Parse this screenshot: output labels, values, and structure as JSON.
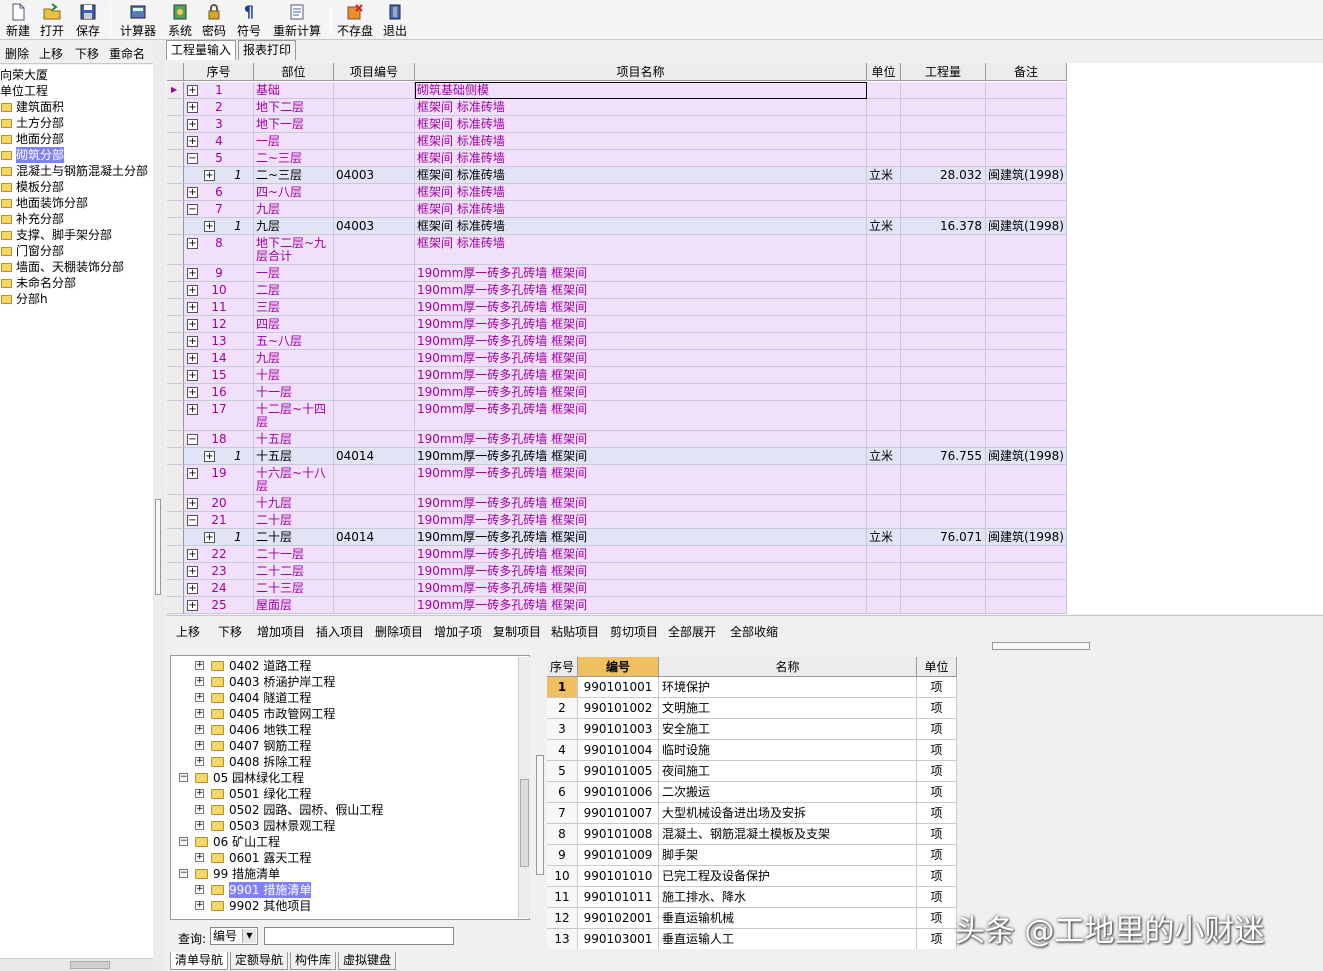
{
  "toolbar": {
    "new": "新建",
    "open": "打开",
    "save": "保存",
    "calc": "计算器",
    "system": "系统",
    "password": "密码",
    "symbol": "符号",
    "recalc": "重新计算",
    "nosave": "不存盘",
    "exit": "退出"
  },
  "left_toolbar": {
    "delete": "删除",
    "up": "上移",
    "down": "下移",
    "rename": "重命名"
  },
  "left_tree": {
    "project": "向荣大厦",
    "unit": "单位工程",
    "items": [
      "建筑面积",
      "土方分部",
      "地面分部",
      "砌筑分部",
      "混凝土与钢筋混凝土分部",
      "模板分部",
      "地面装饰分部",
      "补充分部",
      "支撑、脚手架分部",
      "门窗分部",
      "墙面、天棚装饰分部",
      "未命名分部",
      "分部h"
    ],
    "selected_index": 3
  },
  "tabs": {
    "input": "工程量输入",
    "report": "报表打印"
  },
  "grid": {
    "headers": {
      "seq": "序号",
      "part": "部位",
      "code": "项目编号",
      "name": "项目名称",
      "unit": "单位",
      "qty": "工程量",
      "note": "备注"
    },
    "rows": [
      {
        "type": "parent",
        "seq": "1",
        "part": "基础",
        "code": "",
        "name": "砌筑基础侧模",
        "unit": "",
        "qty": "",
        "note": "",
        "pm": "+",
        "cur": true
      },
      {
        "type": "parent",
        "seq": "2",
        "part": "地下二层",
        "code": "",
        "name": "框架间 标准砖墙",
        "unit": "",
        "qty": "",
        "note": "",
        "pm": "+"
      },
      {
        "type": "parent",
        "seq": "3",
        "part": "地下一层",
        "code": "",
        "name": "框架间 标准砖墙",
        "unit": "",
        "qty": "",
        "note": "",
        "pm": "+"
      },
      {
        "type": "parent",
        "seq": "4",
        "part": "一层",
        "code": "",
        "name": "框架间 标准砖墙",
        "unit": "",
        "qty": "",
        "note": "",
        "pm": "+"
      },
      {
        "type": "parent",
        "seq": "5",
        "part": "二~三层",
        "code": "",
        "name": "框架间 标准砖墙",
        "unit": "",
        "qty": "",
        "note": "",
        "pm": "−"
      },
      {
        "type": "child",
        "seq": "1",
        "part": "二~三层",
        "code": "04003",
        "name": "框架间 标准砖墙",
        "unit": "立米",
        "qty": "28.032",
        "note": "闽建筑(1998)",
        "pm": "+"
      },
      {
        "type": "parent",
        "seq": "6",
        "part": "四~八层",
        "code": "",
        "name": "框架间 标准砖墙",
        "unit": "",
        "qty": "",
        "note": "",
        "pm": "+"
      },
      {
        "type": "parent",
        "seq": "7",
        "part": "九层",
        "code": "",
        "name": "框架间 标准砖墙",
        "unit": "",
        "qty": "",
        "note": "",
        "pm": "−"
      },
      {
        "type": "child",
        "seq": "1",
        "part": "九层",
        "code": "04003",
        "name": "框架间 标准砖墙",
        "unit": "立米",
        "qty": "16.378",
        "note": "闽建筑(1998)",
        "pm": "+"
      },
      {
        "type": "parent",
        "seq": "8",
        "part": "地下二层~九层合计",
        "code": "",
        "name": "框架间 标准砖墙",
        "unit": "",
        "qty": "",
        "note": "",
        "pm": "+",
        "tall": true
      },
      {
        "type": "parent",
        "seq": "9",
        "part": "一层",
        "code": "",
        "name": "190mm厚一砖多孔砖墙 框架间",
        "unit": "",
        "qty": "",
        "note": "",
        "pm": "+"
      },
      {
        "type": "parent",
        "seq": "10",
        "part": "二层",
        "code": "",
        "name": "190mm厚一砖多孔砖墙 框架间",
        "unit": "",
        "qty": "",
        "note": "",
        "pm": "+"
      },
      {
        "type": "parent",
        "seq": "11",
        "part": "三层",
        "code": "",
        "name": "190mm厚一砖多孔砖墙 框架间",
        "unit": "",
        "qty": "",
        "note": "",
        "pm": "+"
      },
      {
        "type": "parent",
        "seq": "12",
        "part": "四层",
        "code": "",
        "name": "190mm厚一砖多孔砖墙 框架间",
        "unit": "",
        "qty": "",
        "note": "",
        "pm": "+"
      },
      {
        "type": "parent",
        "seq": "13",
        "part": "五~八层",
        "code": "",
        "name": "190mm厚一砖多孔砖墙 框架间",
        "unit": "",
        "qty": "",
        "note": "",
        "pm": "+"
      },
      {
        "type": "parent",
        "seq": "14",
        "part": "九层",
        "code": "",
        "name": "190mm厚一砖多孔砖墙 框架间",
        "unit": "",
        "qty": "",
        "note": "",
        "pm": "+"
      },
      {
        "type": "parent",
        "seq": "15",
        "part": "十层",
        "code": "",
        "name": "190mm厚一砖多孔砖墙 框架间",
        "unit": "",
        "qty": "",
        "note": "",
        "pm": "+"
      },
      {
        "type": "parent",
        "seq": "16",
        "part": "十一层",
        "code": "",
        "name": "190mm厚一砖多孔砖墙 框架间",
        "unit": "",
        "qty": "",
        "note": "",
        "pm": "+"
      },
      {
        "type": "parent",
        "seq": "17",
        "part": "十二层~十四层",
        "code": "",
        "name": "190mm厚一砖多孔砖墙 框架间",
        "unit": "",
        "qty": "",
        "note": "",
        "pm": "+",
        "tall": true
      },
      {
        "type": "parent",
        "seq": "18",
        "part": "十五层",
        "code": "",
        "name": "190mm厚一砖多孔砖墙 框架间",
        "unit": "",
        "qty": "",
        "note": "",
        "pm": "−"
      },
      {
        "type": "child",
        "seq": "1",
        "part": "十五层",
        "code": "04014",
        "name": "190mm厚一砖多孔砖墙 框架间",
        "unit": "立米",
        "qty": "76.755",
        "note": "闽建筑(1998)",
        "pm": "+"
      },
      {
        "type": "parent",
        "seq": "19",
        "part": "十六层~十八层",
        "code": "",
        "name": "190mm厚一砖多孔砖墙 框架间",
        "unit": "",
        "qty": "",
        "note": "",
        "pm": "+",
        "tall": true
      },
      {
        "type": "parent",
        "seq": "20",
        "part": "十九层",
        "code": "",
        "name": "190mm厚一砖多孔砖墙 框架间",
        "unit": "",
        "qty": "",
        "note": "",
        "pm": "+"
      },
      {
        "type": "parent",
        "seq": "21",
        "part": "二十层",
        "code": "",
        "name": "190mm厚一砖多孔砖墙 框架间",
        "unit": "",
        "qty": "",
        "note": "",
        "pm": "−"
      },
      {
        "type": "child",
        "seq": "1",
        "part": "二十层",
        "code": "04014",
        "name": "190mm厚一砖多孔砖墙 框架间",
        "unit": "立米",
        "qty": "76.071",
        "note": "闽建筑(1998)",
        "pm": "+"
      },
      {
        "type": "parent",
        "seq": "22",
        "part": "二十一层",
        "code": "",
        "name": "190mm厚一砖多孔砖墙 框架间",
        "unit": "",
        "qty": "",
        "note": "",
        "pm": "+"
      },
      {
        "type": "parent",
        "seq": "23",
        "part": "二十二层",
        "code": "",
        "name": "190mm厚一砖多孔砖墙 框架间",
        "unit": "",
        "qty": "",
        "note": "",
        "pm": "+"
      },
      {
        "type": "parent",
        "seq": "24",
        "part": "二十三层",
        "code": "",
        "name": "190mm厚一砖多孔砖墙 框架间",
        "unit": "",
        "qty": "",
        "note": "",
        "pm": "+"
      },
      {
        "type": "parent",
        "seq": "25",
        "part": "屋面层",
        "code": "",
        "name": "190mm厚一砖多孔砖墙 框架间",
        "unit": "",
        "qty": "",
        "note": "",
        "pm": "+"
      }
    ]
  },
  "buttons": [
    "上移",
    "下移",
    "增加项目",
    "插入项目",
    "删除项目",
    "增加子项",
    "复制项目",
    "粘贴项目",
    "剪切项目",
    "全部展开",
    "全部收缩"
  ],
  "nav_tree": [
    {
      "level": 2,
      "pm": "+",
      "label": "0402 道路工程"
    },
    {
      "level": 2,
      "pm": "+",
      "label": "0403 桥涵护岸工程"
    },
    {
      "level": 2,
      "pm": "+",
      "label": "0404 隧道工程"
    },
    {
      "level": 2,
      "pm": "+",
      "label": "0405 市政管网工程"
    },
    {
      "level": 2,
      "pm": "+",
      "label": "0406 地铁工程"
    },
    {
      "level": 2,
      "pm": "+",
      "label": "0407 钢筋工程"
    },
    {
      "level": 2,
      "pm": "+",
      "label": "0408 拆除工程"
    },
    {
      "level": 1,
      "pm": "−",
      "label": "05  园林绿化工程"
    },
    {
      "level": 2,
      "pm": "+",
      "label": "0501 绿化工程"
    },
    {
      "level": 2,
      "pm": "+",
      "label": "0502 园路、园桥、假山工程"
    },
    {
      "level": 2,
      "pm": "+",
      "label": "0503 园林景观工程"
    },
    {
      "level": 1,
      "pm": "−",
      "label": "06  矿山工程"
    },
    {
      "level": 2,
      "pm": "+",
      "label": "0601 露天工程"
    },
    {
      "level": 1,
      "pm": "−",
      "label": "99  措施清单"
    },
    {
      "level": 2,
      "pm": "+",
      "label": "9901 措施清单",
      "selected": true
    },
    {
      "level": 2,
      "pm": "+",
      "label": "9902 其他项目"
    }
  ],
  "query": {
    "label": "查询:",
    "field": "编号",
    "value": ""
  },
  "code_table": {
    "headers": {
      "seq": "序号",
      "code": "编号",
      "name": "名称",
      "unit": "单位"
    },
    "rows": [
      {
        "seq": "1",
        "code": "990101001",
        "name": "环境保护",
        "unit": "项"
      },
      {
        "seq": "2",
        "code": "990101002",
        "name": "文明施工",
        "unit": "项"
      },
      {
        "seq": "3",
        "code": "990101003",
        "name": "安全施工",
        "unit": "项"
      },
      {
        "seq": "4",
        "code": "990101004",
        "name": "临时设施",
        "unit": "项"
      },
      {
        "seq": "5",
        "code": "990101005",
        "name": "夜间施工",
        "unit": "项"
      },
      {
        "seq": "6",
        "code": "990101006",
        "name": "二次搬运",
        "unit": "项"
      },
      {
        "seq": "7",
        "code": "990101007",
        "name": "大型机械设备进出场及安拆",
        "unit": "项"
      },
      {
        "seq": "8",
        "code": "990101008",
        "name": "混凝土、钢筋混凝土模板及支架",
        "unit": "项"
      },
      {
        "seq": "9",
        "code": "990101009",
        "name": "脚手架",
        "unit": "项"
      },
      {
        "seq": "10",
        "code": "990101010",
        "name": "已完工程及设备保护",
        "unit": "项"
      },
      {
        "seq": "11",
        "code": "990101011",
        "name": "施工排水、降水",
        "unit": "项"
      },
      {
        "seq": "12",
        "code": "990102001",
        "name": "垂直运输机械",
        "unit": "项"
      },
      {
        "seq": "13",
        "code": "990103001",
        "name": "垂直运输人工",
        "unit": "项"
      }
    ]
  },
  "bottom_tabs": [
    "清单导航",
    "定额导航",
    "构件库",
    "虚拟键盘"
  ],
  "watermark": "头条 @工地里的小财迷"
}
